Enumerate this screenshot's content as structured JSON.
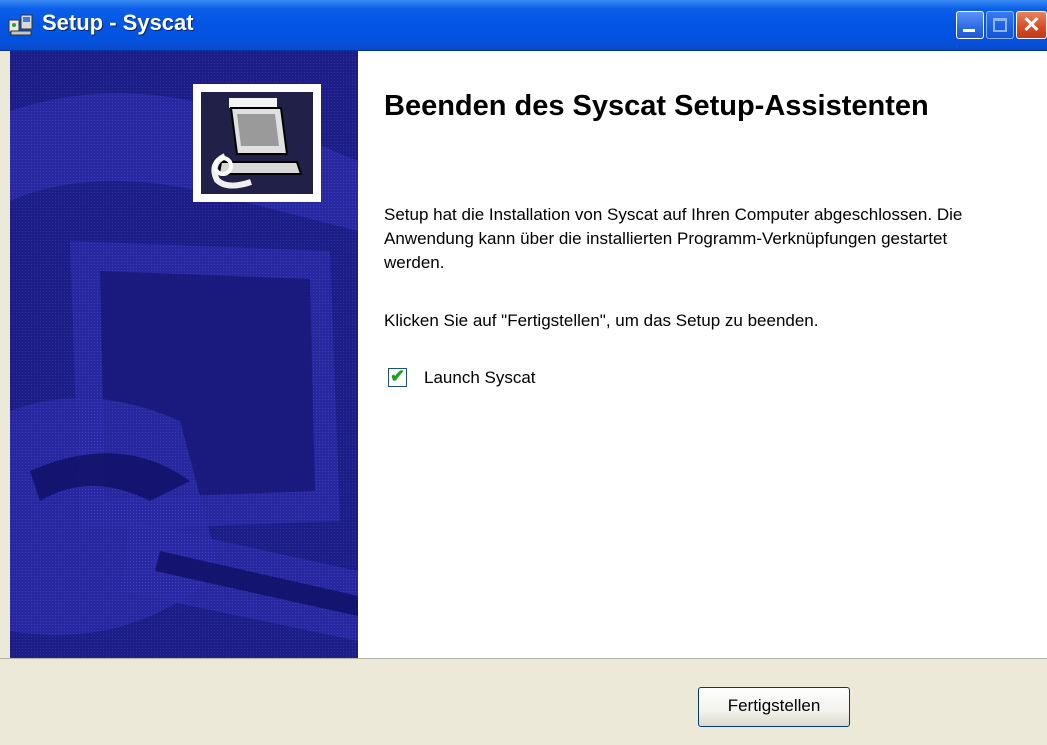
{
  "window": {
    "title": "Setup - Syscat",
    "controls": {
      "minimize": "minimize-button",
      "maximize": "maximize-button",
      "close": "close-button"
    }
  },
  "content": {
    "heading": "Beenden des Syscat Setup-Assistenten",
    "paragraph1": "Setup hat die Installation von Syscat auf Ihren Computer abgeschlossen. Die Anwendung kann über die installierten Programm-Verknüpfungen gestartet werden.",
    "paragraph2": "Klicken Sie auf \"Fertigstellen\", um das Setup zu beenden.",
    "launch_checkbox": {
      "label": "Launch Syscat",
      "checked": true
    }
  },
  "footer": {
    "finish_label": "Fertigstellen"
  },
  "colors": {
    "titlebar": "#0454E4",
    "banner": "#1E1E8C",
    "dialog_bg": "#ECE9D8",
    "close": "#D84A24"
  },
  "icons": {
    "app": "installer-icon",
    "banner_logo": "computer-install-icon"
  }
}
